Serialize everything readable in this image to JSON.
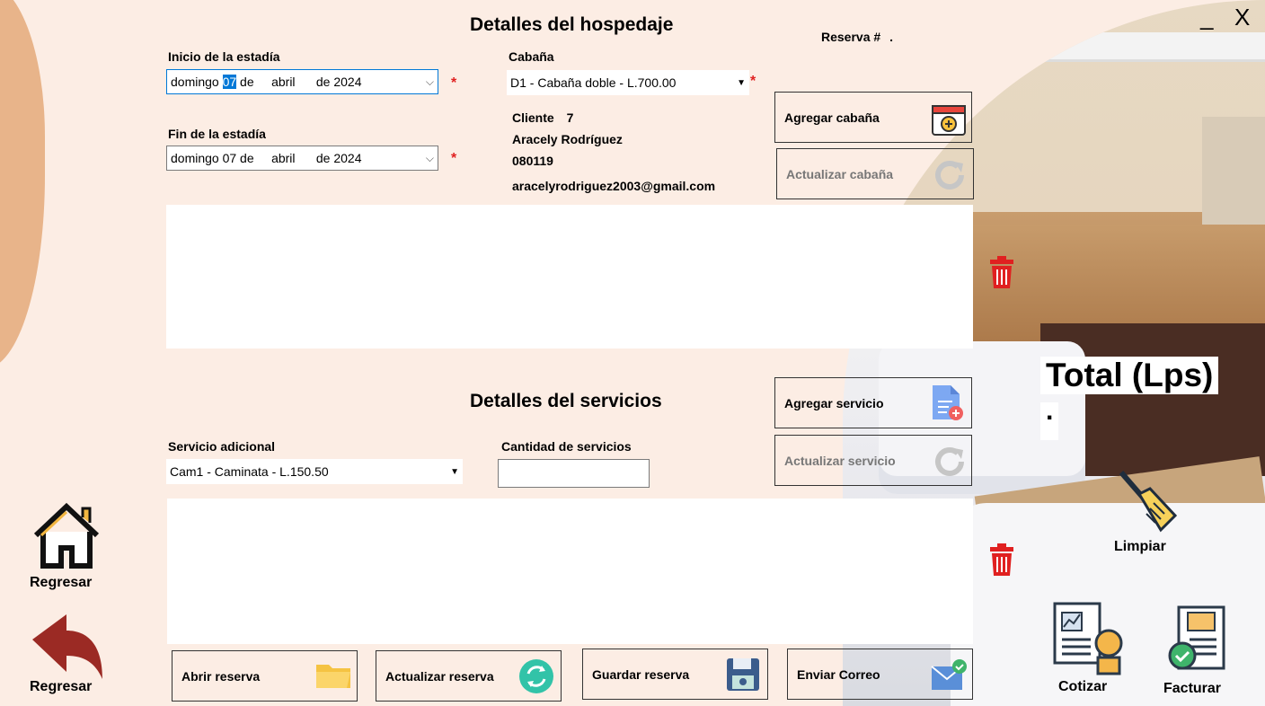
{
  "window": {
    "minimize_label": "_",
    "close_label": "X"
  },
  "hospedaje": {
    "title": "Detalles del hospedaje",
    "reserva_label": "Reserva #",
    "reserva_value": ".",
    "inicio_label": "Inicio de la estadía",
    "inicio_day": "domingo ",
    "inicio_date": "07",
    "inicio_rest": " de     abril      de 2024",
    "fin_label": "Fin de la estadía",
    "fin_value": "domingo 07 de     abril      de 2024",
    "cabana_label": "Cabaña",
    "cabana_value": "D1 - Cabaña doble - L.700.00",
    "cliente_label": "Cliente",
    "cliente_id": "7",
    "cliente_name": "Aracely Rodríguez",
    "cliente_code": "080119",
    "cliente_email": "aracelyrodriguez2003@gmail.com",
    "required_mark": "*",
    "add_cabin_label": "Agregar cabaña",
    "update_cabin_label": "Actualizar cabaña"
  },
  "servicios": {
    "title": "Detalles del servicios",
    "servicio_label": "Servicio adicional",
    "servicio_value": "Cam1 - Caminata - L.150.50",
    "cantidad_label": "Cantidad de servicios",
    "cantidad_value": "",
    "add_service_label": "Agregar servicio",
    "update_service_label": "Actualizar servicio"
  },
  "total": {
    "label": "Total (Lps)",
    "value": "."
  },
  "actions": {
    "clear_label": "Limpiar",
    "quote_label": "Cotizar",
    "invoice_label": "Facturar",
    "open_label": "Abrir reserva",
    "update_label": "Actualizar reserva",
    "save_label": "Guardar reserva",
    "email_label": "Enviar Correo"
  },
  "nav": {
    "home_label": "Regresar",
    "back_label": "Regresar"
  },
  "colors": {
    "background": "#fcede4",
    "accent": "#0078d7",
    "required": "#e02020",
    "trash": "#e02020",
    "back_arrow": "#9b2a24"
  }
}
